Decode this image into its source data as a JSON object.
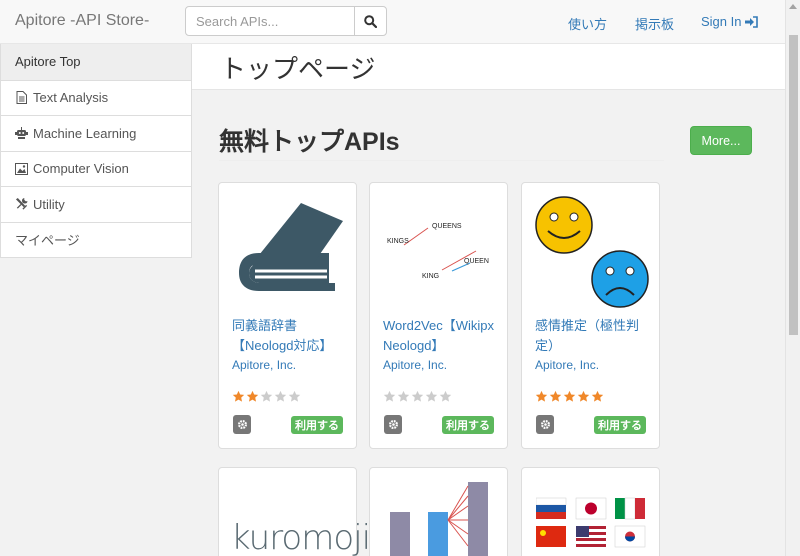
{
  "navbar": {
    "brand": "Apitore -API Store-",
    "search_placeholder": "Search APIs...",
    "links": {
      "usage": "使い方",
      "board": "掲示板",
      "signin": "Sign In"
    }
  },
  "sidebar": {
    "items": [
      {
        "label": "Apitore Top",
        "icon": "none",
        "active": true
      },
      {
        "label": "Text Analysis",
        "icon": "document-icon"
      },
      {
        "label": "Machine Learning",
        "icon": "robot-icon"
      },
      {
        "label": "Computer Vision",
        "icon": "picture-icon"
      },
      {
        "label": "Utility",
        "icon": "tools-icon"
      },
      {
        "label": "マイページ",
        "icon": "none"
      }
    ]
  },
  "page": {
    "title": "トップページ"
  },
  "section": {
    "title": "無料トップAPIs",
    "more_label": "More..."
  },
  "cards": [
    {
      "name": "同義語辞書【Neologd対応】",
      "company": "Apitore, Inc.",
      "rating": 2,
      "use_label": "利用する",
      "image": "book-icon"
    },
    {
      "name": "Word2Vec【Wikipx Neologd】",
      "company": "Apitore, Inc.",
      "rating": 0,
      "use_label": "利用する",
      "image": "word-vector-diagram"
    },
    {
      "name": "感情推定（極性判定）",
      "company": "Apitore, Inc.",
      "rating": 5,
      "use_label": "利用する",
      "image": "smiley-faces"
    }
  ],
  "word2vec_labels": {
    "kings": "KINGS",
    "queens": "QUEENS",
    "king": "KING",
    "queen": "QUEEN"
  },
  "bottom_cards": [
    {
      "image": "kuromoji-logo",
      "logo_text": "kuromoji"
    },
    {
      "image": "bar-chart-icon"
    },
    {
      "image": "flags-icon"
    }
  ],
  "colors": {
    "link": "#337ab7",
    "success": "#5cb85c",
    "star_on": "#f0882a",
    "star_off": "#cccccc"
  }
}
